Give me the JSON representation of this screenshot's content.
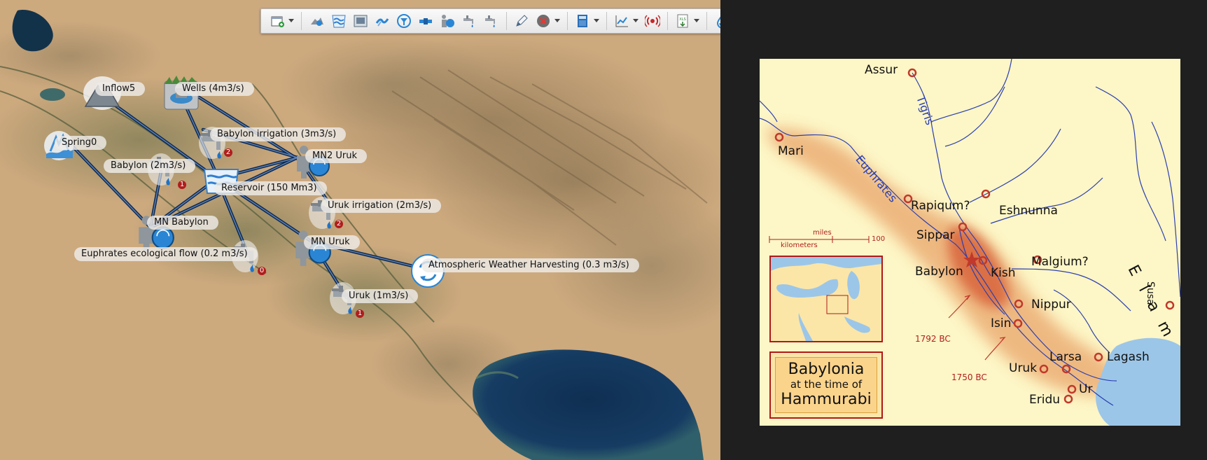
{
  "toolbar": {
    "buttons": [
      {
        "name": "add-layer-icon"
      },
      {
        "name": "catchment-icon"
      },
      {
        "name": "reservoir-tool-icon"
      },
      {
        "name": "image-tool-icon"
      },
      {
        "name": "weather-tool-icon"
      },
      {
        "name": "filter-icon"
      },
      {
        "name": "pipe-icon"
      },
      {
        "name": "pump-demand-icon"
      },
      {
        "name": "tap-tool-icon"
      },
      {
        "name": "tap-tool-2-icon"
      },
      {
        "name": "edit-pencil-icon"
      },
      {
        "name": "delete-icon"
      },
      {
        "name": "calculator-icon"
      },
      {
        "name": "chart-icon"
      },
      {
        "name": "signal-icon"
      },
      {
        "name": "export-xls-icon"
      },
      {
        "name": "water-drop-icon"
      }
    ],
    "export_label": "XLS"
  },
  "network": {
    "nodes": [
      {
        "id": "inflow5",
        "label": "Inflow5",
        "icon": "inflow-mountain-icon"
      },
      {
        "id": "wells",
        "label": "Wells (4m3/s)",
        "icon": "wells-icon"
      },
      {
        "id": "spring0",
        "label": "Spring0",
        "icon": "spring-icon"
      },
      {
        "id": "babylon-irrigation",
        "label": "Babylon irrigation (3m3/s)",
        "icon": "tap-icon",
        "badge": "2"
      },
      {
        "id": "babylon",
        "label": "Babylon (2m3/s)",
        "icon": "tap-icon",
        "badge": "1"
      },
      {
        "id": "mn2-uruk",
        "label": "MN2 Uruk",
        "icon": "demand-node-icon"
      },
      {
        "id": "reservoir",
        "label": "Reservoir (150 Mm3)",
        "icon": "reservoir-icon"
      },
      {
        "id": "uruk-irrigation",
        "label": "Uruk irrigation (2m3/s)",
        "icon": "tap-icon",
        "badge": "2"
      },
      {
        "id": "mn-babylon",
        "label": "MN Babylon",
        "icon": "demand-node-icon"
      },
      {
        "id": "euphrates-flow",
        "label": "Euphrates ecological flow (0.2 m3/s)",
        "icon": "tap-icon",
        "badge": "0"
      },
      {
        "id": "mn-uruk",
        "label": "MN Uruk",
        "icon": "demand-node-icon"
      },
      {
        "id": "weather",
        "label": "Atmospheric Weather Harvesting (0.3 m3/s)",
        "icon": "recycle-icon"
      },
      {
        "id": "uruk",
        "label": "Uruk (1m3/s)",
        "icon": "tap-icon",
        "badge": "1"
      }
    ]
  },
  "map": {
    "cities": {
      "assur": "Assur",
      "mari": "Mari",
      "rapiqum": "Rapiqum?",
      "eshnunna": "Eshnunna",
      "sippar": "Sippar",
      "babylon": "Babylon",
      "kish": "Kish",
      "malgium": "Malgium?",
      "nippur": "Nippur",
      "isin": "Isin",
      "uruk": "Uruk",
      "larsa": "Larsa",
      "lagash": "Lagash",
      "ur": "Ur",
      "eridu": "Eridu",
      "susa": "Susa"
    },
    "rivers": {
      "tigris": "Tigris",
      "euphrates": "Euphrates"
    },
    "region": "E l a m",
    "dates": {
      "d1792": "1792 BC",
      "d1750": "1750 BC"
    },
    "scale": {
      "miles": "miles",
      "kilometers": "kilometers",
      "hundred": "100"
    },
    "title": {
      "line1": "Babylonia",
      "line2": "at the time of",
      "line3": "Hammurabi"
    },
    "colors": {
      "background": "#fdf6c6",
      "empire_1792": "#e9a46a",
      "empire_1750": "#d8643a",
      "river": "#2a3fb0",
      "city": "#c0392b",
      "sea": "#9cc6e8"
    }
  }
}
